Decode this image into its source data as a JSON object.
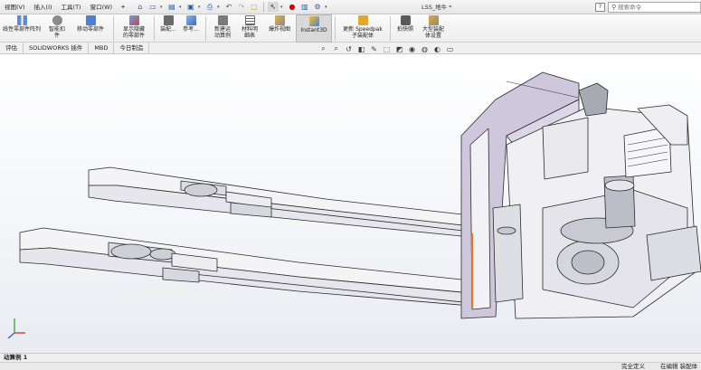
{
  "menubar": {
    "items": [
      "视图(V)",
      "插入(I)",
      "工具(T)",
      "窗口(W)"
    ],
    "pin_glyph": "✦"
  },
  "quick_access": {
    "icons": [
      "home-icon",
      "new-document-icon",
      "open-folder-icon",
      "save-icon",
      "print-icon",
      "undo-icon",
      "redo-icon",
      "select-cursor-icon",
      "rebuild-icon",
      "file-properties-icon",
      "options-icon"
    ]
  },
  "document_title": "LSS_地牛 *",
  "help_label": "?",
  "search": {
    "placeholder": "搜索命令"
  },
  "ribbon": {
    "buttons": [
      {
        "id": "linear-pattern",
        "label1": "线性零部件阵列",
        "label2": ""
      },
      {
        "id": "smart-fasteners",
        "label1": "智能扣",
        "label2": "件"
      },
      {
        "id": "move-component",
        "label1": "移动零部件",
        "label2": ""
      },
      {
        "id": "show-hidden",
        "label1": "显示隐藏",
        "label2": "的零部件"
      },
      {
        "id": "assembly-features",
        "label1": "装配...",
        "label2": ""
      },
      {
        "id": "reference-geometry",
        "label1": "参考...",
        "label2": ""
      },
      {
        "id": "new-motion-study",
        "label1": "新建运",
        "label2": "动算例"
      },
      {
        "id": "bill-of-materials",
        "label1": "材料明",
        "label2": "细表"
      },
      {
        "id": "exploded-view",
        "label1": "爆炸视图",
        "label2": ""
      },
      {
        "id": "instant3d",
        "label1": "Instant3D",
        "label2": ""
      },
      {
        "id": "update-speedpak",
        "label1": "更新 Speedpak",
        "label2": "子装配体"
      },
      {
        "id": "take-snapshot",
        "label1": "拍快照",
        "label2": ""
      },
      {
        "id": "large-assembly",
        "label1": "大型装配",
        "label2": "体设置"
      }
    ]
  },
  "tabs": [
    "评估",
    "SOLIDWORKS 插件",
    "MBD",
    "今日制造"
  ],
  "model_tabs": [
    "动算例 1"
  ],
  "status": {
    "fully_defined": "完全定义",
    "editing": "在编辑 装配体"
  },
  "colors": {
    "accent": "#2f5aa8",
    "orange_highlight": "#e07a1f",
    "part_fill": "#f4f4f7",
    "frame_fill": "#cfc8dc",
    "edge": "#2b2b2b"
  }
}
